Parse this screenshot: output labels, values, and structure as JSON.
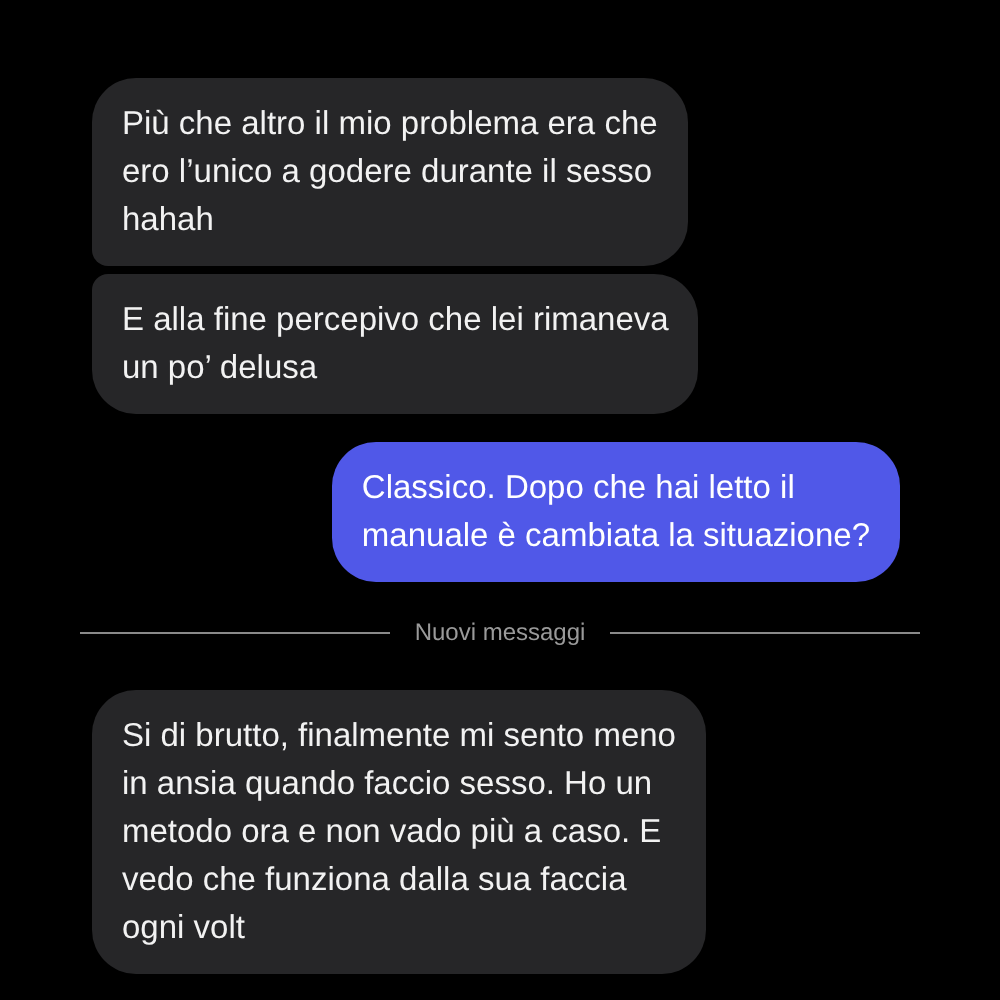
{
  "messages": [
    {
      "kind": "incoming",
      "text": "Più che altro il mio problema era che\nero l’unico a godere durante il sesso\nhahah"
    },
    {
      "kind": "incoming",
      "text": "E alla fine percepivo che lei rimaneva\nun po’ delusa"
    },
    {
      "kind": "outgoing",
      "text": "Classico. Dopo che hai letto il\nmanuale è cambiata la situazione?"
    },
    {
      "kind": "divider",
      "text": "Nuovi messaggi"
    },
    {
      "kind": "incoming",
      "text": "Si di brutto, finalmente mi sento meno\nin ansia quando faccio sesso. Ho un\nmetodo ora e non vado più a caso. E\nvedo che funziona dalla sua faccia\nogni volt"
    }
  ]
}
